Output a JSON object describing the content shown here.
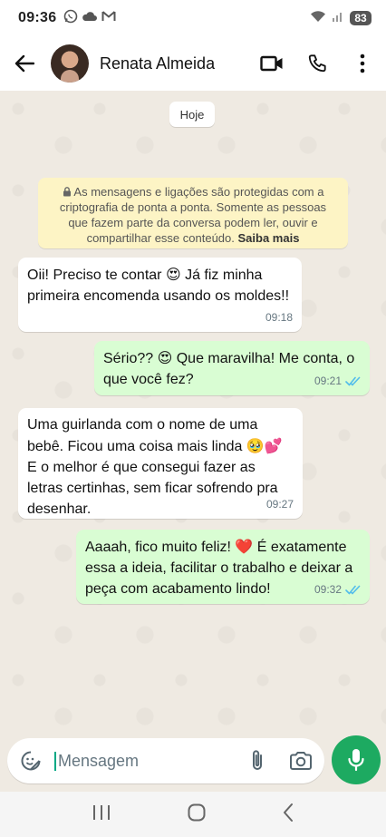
{
  "status_bar": {
    "time": "09:36",
    "battery": "83"
  },
  "header": {
    "contact_name": "Renata Almeida"
  },
  "chat": {
    "date_chip": "Hoje",
    "encryption_notice": {
      "text": "As mensagens e ligações são protegidas com a criptografia de ponta a ponta. Somente as pessoas que fazem parte da conversa podem ler, ouvir e compartilhar esse conteúdo.",
      "link": "Saiba mais"
    },
    "messages": [
      {
        "direction": "in",
        "text_before": "Oii! Preciso te contar ",
        "emoji": "😍",
        "text_after": " Já fiz minha primeira encomenda usando os moldes!!",
        "time": "09:18"
      },
      {
        "direction": "out",
        "text_before": "Sério?? ",
        "emoji": "😍",
        "text_after": " Que maravilha! Me conta, o que você fez?",
        "time": "09:21",
        "status": "read"
      },
      {
        "direction": "in",
        "text_before": "Uma guirlanda com o nome de uma bebê. Ficou uma coisa mais linda ",
        "emoji": "🥹💕",
        "text_after": " E o melhor é que consegui fazer as letras certinhas, sem ficar sofrendo pra desenhar.",
        "time": "09:27"
      },
      {
        "direction": "out",
        "text_before": "Aaaah, fico muito feliz! ",
        "emoji": "❤️",
        "text_after": " É exatamente essa a ideia, facilitar o trabalho e deixar a peça com acabamento lindo!",
        "time": "09:32",
        "status": "read"
      }
    ]
  },
  "composer": {
    "placeholder": "Mensagem"
  },
  "colors": {
    "accent": "#00a884",
    "mic_button": "#1daa61",
    "read_ticks": "#53bdeb",
    "outgoing_bubble": "#d9fdd3",
    "incoming_bubble": "#ffffff",
    "chat_background": "#efeae2",
    "encryption_notice_bg": "#fdf4c5"
  },
  "icons": {
    "status_bar": [
      "whatsapp-icon",
      "cloud-icon",
      "gmail-icon",
      "wifi-icon",
      "signal-icon",
      "battery-icon"
    ],
    "header": [
      "back-arrow-icon",
      "video-call-icon",
      "phone-icon",
      "more-options-icon"
    ],
    "composer": [
      "sticker-icon",
      "attach-icon",
      "camera-icon",
      "mic-icon"
    ],
    "navbar": [
      "recents-icon",
      "home-icon",
      "back-icon"
    ]
  }
}
